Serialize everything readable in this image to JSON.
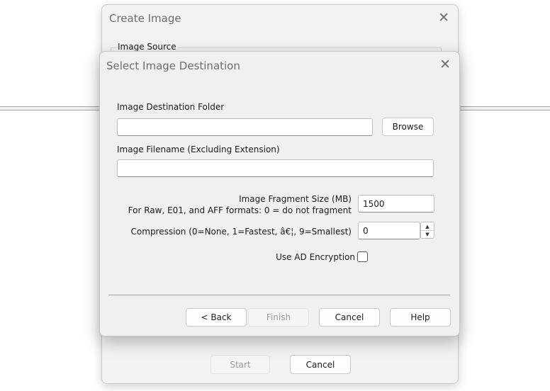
{
  "back_window": {
    "title": "Create Image",
    "group_label": "Image Source",
    "start_label": "Start",
    "cancel_label": "Cancel"
  },
  "dialog": {
    "title": "Select Image Destination",
    "dest_folder_label": "Image Destination Folder",
    "dest_folder_value": "",
    "browse_label": "Browse",
    "filename_label": "Image Filename (Excluding Extension)",
    "filename_value": "",
    "fragment_label_line1": "Image Fragment Size (MB)",
    "fragment_label_line2": "For Raw, E01, and AFF formats: 0 = do not fragment",
    "fragment_value": "1500",
    "compression_label": "Compression (0=None, 1=Fastest, â€¦, 9=Smallest)",
    "compression_value": "0",
    "encryption_label": "Use AD Encryption",
    "encryption_checked": false,
    "back_label": "< Back",
    "finish_label": "Finish",
    "cancel_label": "Cancel",
    "help_label": "Help"
  }
}
